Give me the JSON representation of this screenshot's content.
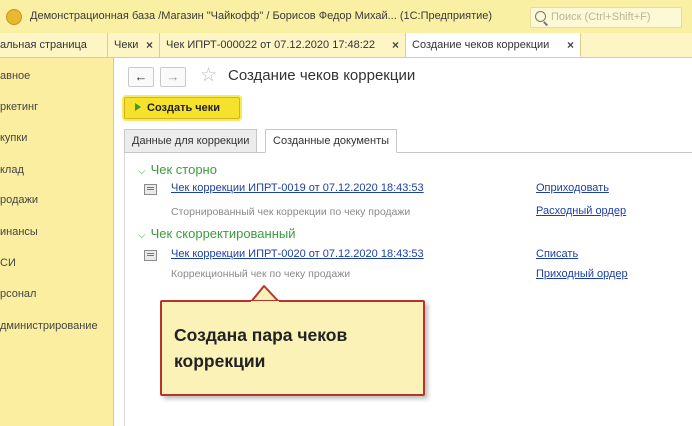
{
  "window": {
    "title": "Демонстрационная база /Магазин \"Чайкофф\" / Борисов Федор Михай...   (1С:Предприятие)",
    "search_placeholder": "Поиск (Ctrl+Shift+F)"
  },
  "tabs": [
    {
      "label": "альная страница"
    },
    {
      "label": "Чеки",
      "close": "×"
    },
    {
      "label": "Чек ИПРТ-000022 от 07.12.2020 17:48:22",
      "close": "×"
    },
    {
      "label": "Создание чеков коррекции",
      "close": "×"
    }
  ],
  "sidebar": {
    "items": [
      {
        "label": "авное"
      },
      {
        "label": "ркетинг"
      },
      {
        "label": "купки"
      },
      {
        "label": "клад"
      },
      {
        "label": "родажи"
      },
      {
        "label": "инансы"
      },
      {
        "label": "СИ"
      },
      {
        "label": "рсонал"
      },
      {
        "label": "дминистрирование"
      }
    ]
  },
  "toolbar": {
    "back": "←",
    "forward": "→",
    "page_title": "Создание чеков коррекции",
    "create_button": "Создать чеки"
  },
  "doc_tabs": {
    "tab1": "Данные для коррекции",
    "tab2": "Созданные документы"
  },
  "groups": [
    {
      "title": "Чек сторно",
      "doc_link": "Чек коррекции ИПРТ-0019 от 07.12.2020 18:43:53",
      "description": "Сторнированный чек коррекции по чеку продажи",
      "action1": "Оприходовать",
      "action2": "Расходный ордер"
    },
    {
      "title": "Чек скорректированный",
      "doc_link": "Чек коррекции ИПРТ-0020 от 07.12.2020 18:43:53",
      "description": "Коррекционный чек по чеку продажи",
      "action1": "Списать",
      "action2": "Приходный ордер"
    }
  ],
  "callout": {
    "text": "Создана пара чеков коррекции"
  }
}
